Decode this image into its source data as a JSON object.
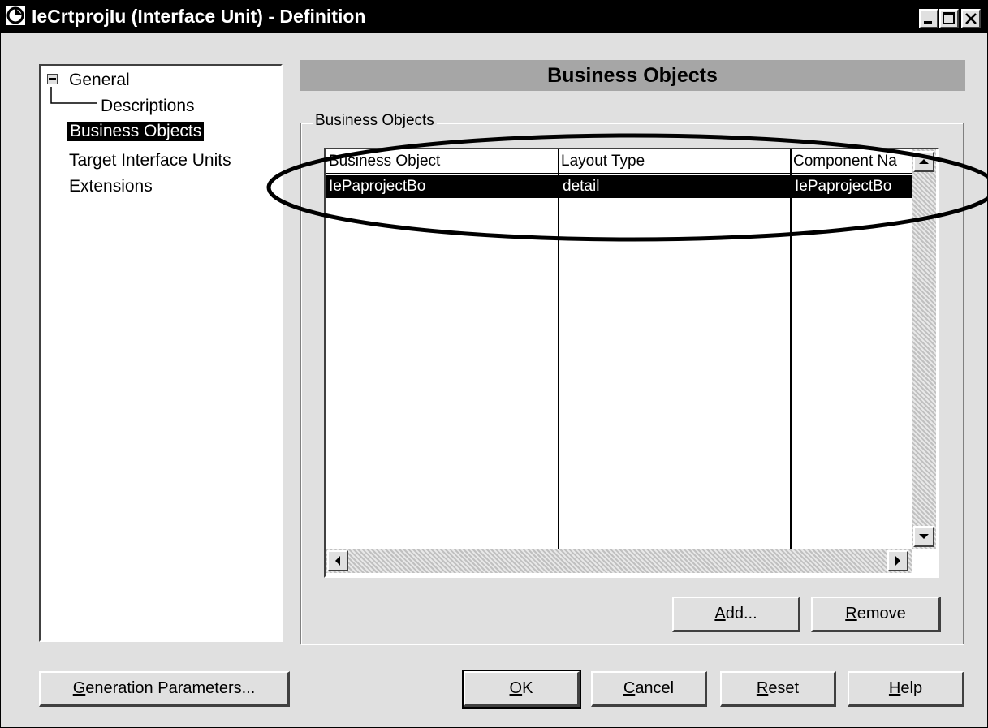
{
  "window": {
    "title": "IeCrtprojIu (Interface Unit) - Definition"
  },
  "tree": {
    "root": "General",
    "items": [
      "Descriptions",
      "Business Objects",
      "Target Interface Units",
      "Extensions"
    ]
  },
  "panel": {
    "header": "Business Objects",
    "group_label": "Business Objects"
  },
  "grid": {
    "columns": [
      "Business Object",
      "Layout Type",
      "Component Na"
    ],
    "rows": [
      [
        "IePaprojectBo",
        "detail",
        "IePaprojectBo"
      ]
    ]
  },
  "buttons": {
    "add_prefix": "A",
    "add_rest": "dd...",
    "remove_prefix": "R",
    "remove_rest": "emove",
    "genparams_prefix": "G",
    "genparams_rest": "eneration Parameters...",
    "ok_prefix": "O",
    "ok_rest": "K",
    "cancel_prefix": "C",
    "cancel_rest": "ancel",
    "reset_prefix": "R",
    "reset_rest": "eset",
    "help_prefix": "H",
    "help_rest": "elp"
  }
}
